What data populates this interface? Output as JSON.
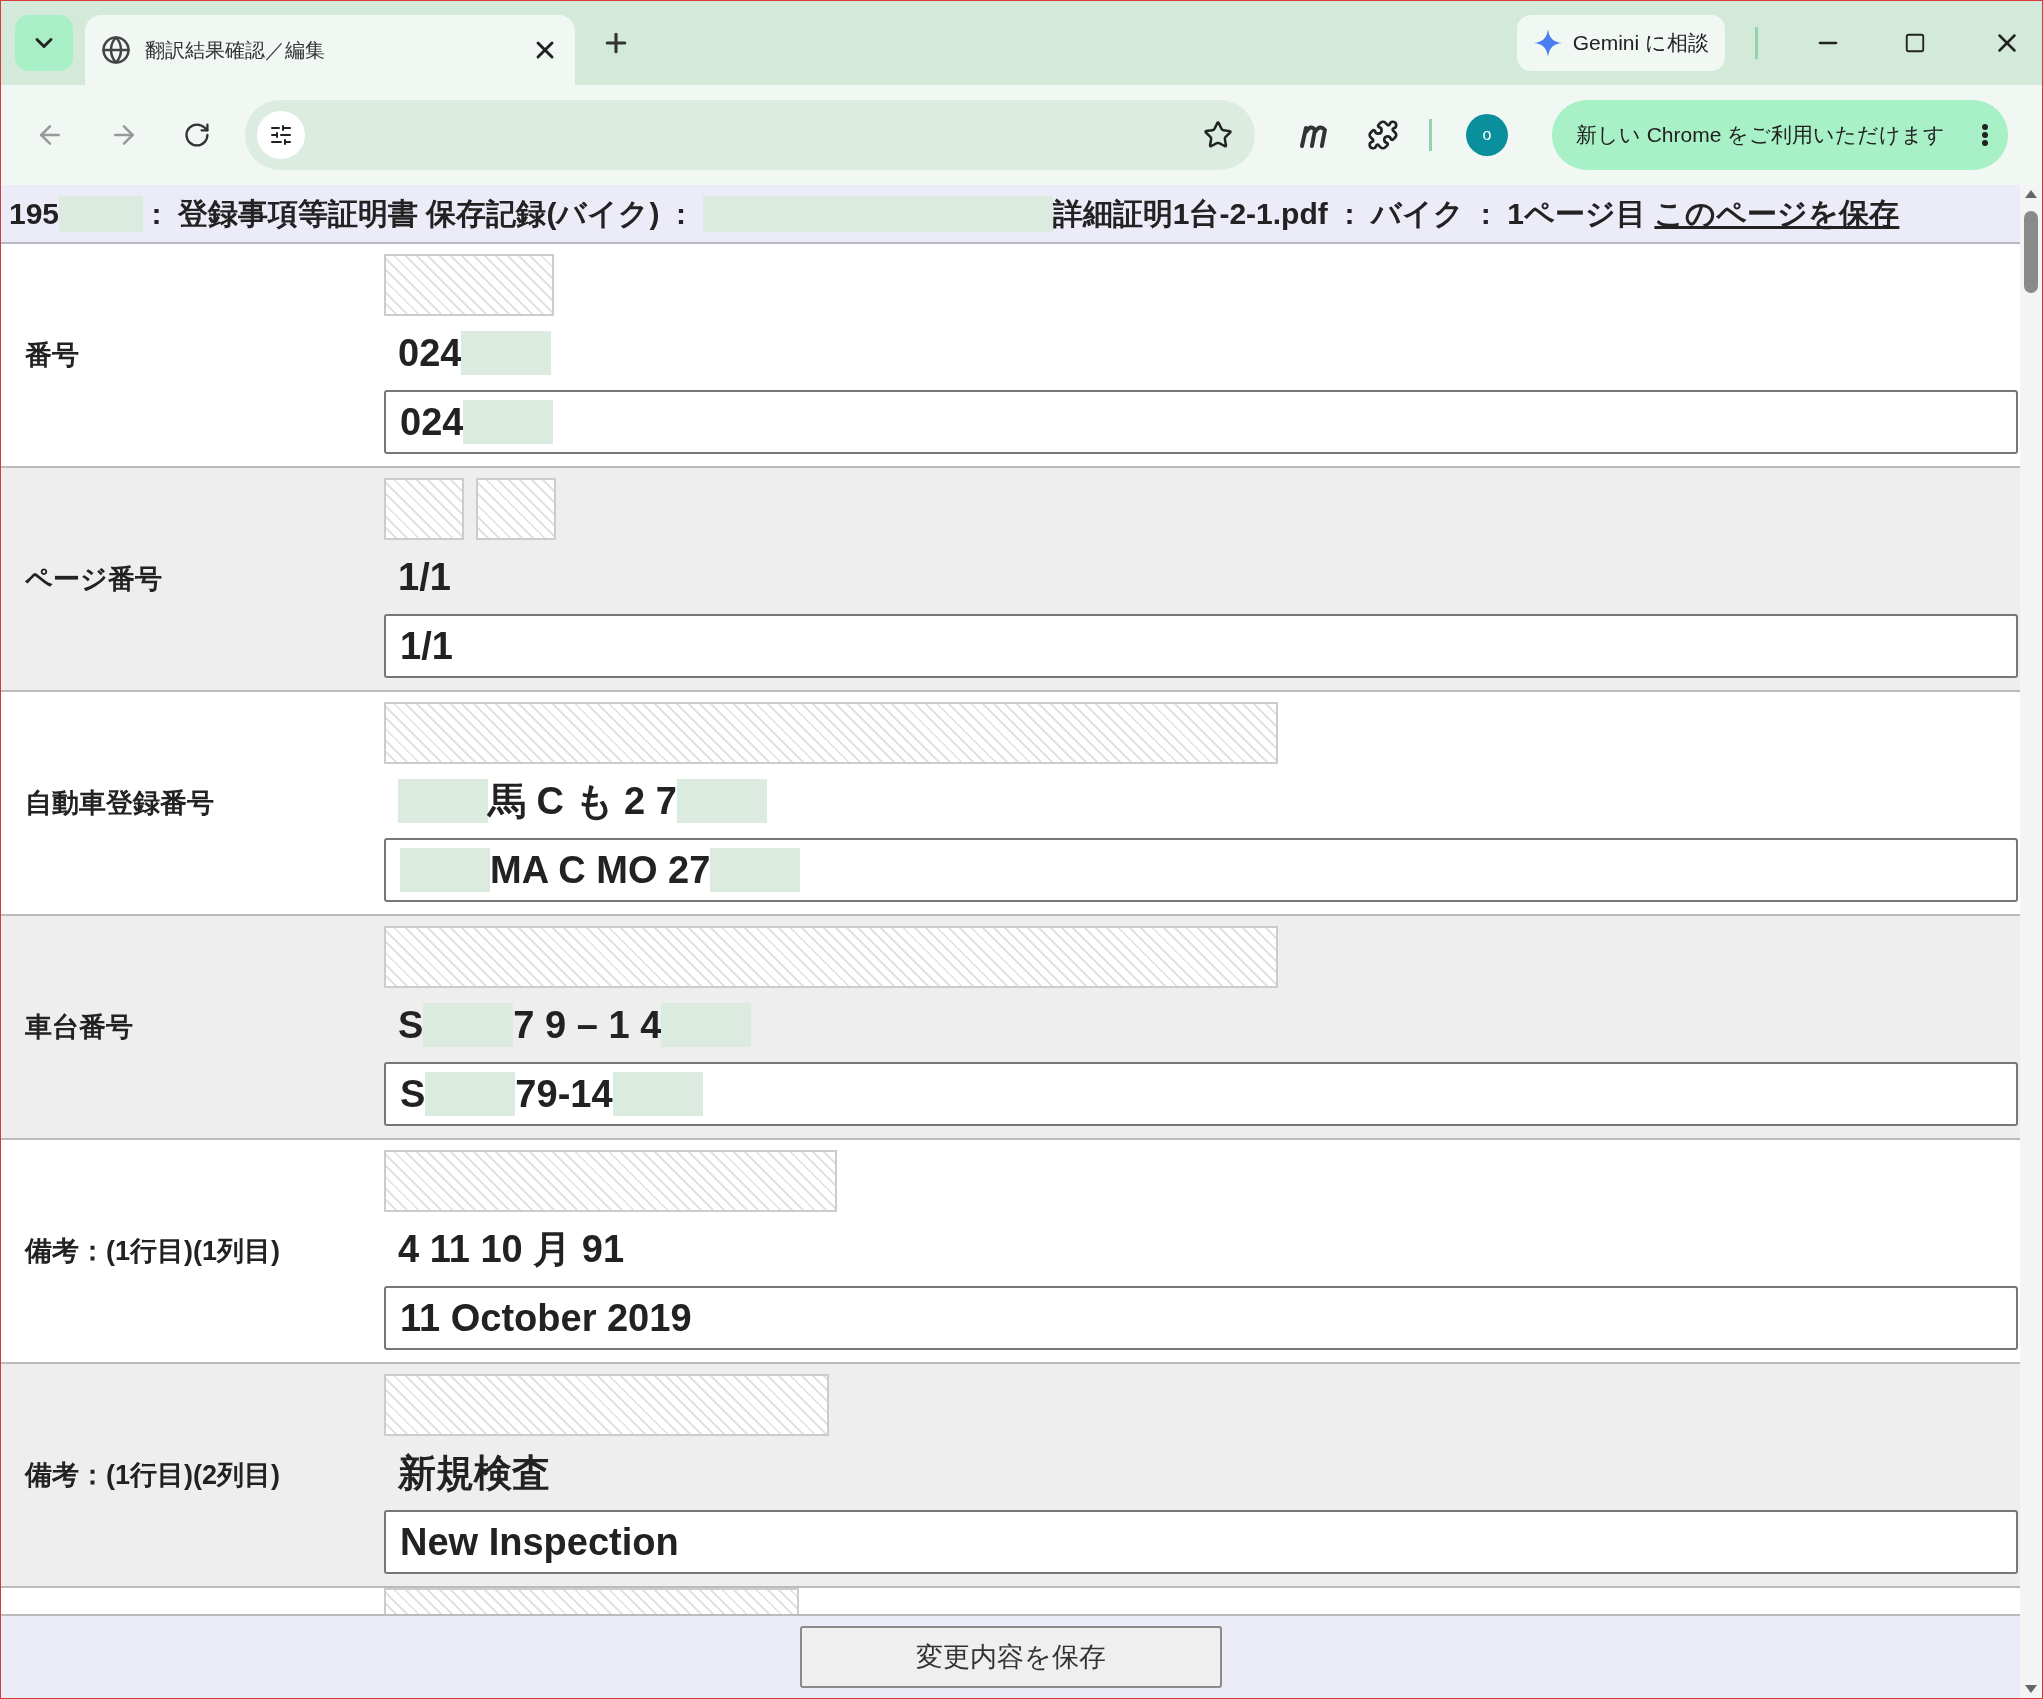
{
  "browser": {
    "tab_title": "翻訳結果確認／編集",
    "gemini_button": "Gemini に相談",
    "avatar_letter": "o",
    "update_banner": "新しい Chrome をご利用いただけます"
  },
  "header": {
    "parts": [
      {
        "kind": "text",
        "text": "195"
      },
      {
        "kind": "redacted"
      },
      {
        "kind": "text",
        "text": " :  登録事項等証明書 保存記録(バイク)  :  "
      },
      {
        "kind": "redacted"
      },
      {
        "kind": "text",
        "text": "詳細証明1台-2-1.pdf  :  バイク  :  1ページ目 "
      },
      {
        "kind": "link",
        "text": "このページを保存"
      }
    ]
  },
  "rows": [
    {
      "label": "番号",
      "ocr": [
        {
          "kind": "text",
          "text": "024"
        },
        {
          "kind": "redacted"
        }
      ],
      "translation": [
        {
          "kind": "text",
          "text": "024"
        },
        {
          "kind": "redacted"
        }
      ]
    },
    {
      "label": "ページ番号",
      "ocr": [
        {
          "kind": "text",
          "text": "1/1"
        }
      ],
      "translation": [
        {
          "kind": "text",
          "text": "1/1"
        }
      ]
    },
    {
      "label": "自動車登録番号",
      "ocr": [
        {
          "kind": "redacted"
        },
        {
          "kind": "text",
          "text": "馬 C も 2 7"
        },
        {
          "kind": "redacted"
        }
      ],
      "translation": [
        {
          "kind": "redacted"
        },
        {
          "kind": "text",
          "text": "MA C MO 27"
        },
        {
          "kind": "redacted"
        }
      ]
    },
    {
      "label": "車台番号",
      "ocr": [
        {
          "kind": "text",
          "text": "S"
        },
        {
          "kind": "redacted"
        },
        {
          "kind": "text",
          "text": "7 9 – 1 4"
        },
        {
          "kind": "redacted"
        }
      ],
      "translation": [
        {
          "kind": "text",
          "text": "S"
        },
        {
          "kind": "redacted"
        },
        {
          "kind": "text",
          "text": "79-14"
        },
        {
          "kind": "redacted"
        }
      ]
    },
    {
      "label": "備考：(1行目)(1列目)",
      "ocr": [
        {
          "kind": "text",
          "text": "4 11 10 月 91"
        }
      ],
      "translation": [
        {
          "kind": "text",
          "text": "11 October 2019"
        }
      ]
    },
    {
      "label": "備考：(1行目)(2列目)",
      "ocr": [
        {
          "kind": "text",
          "text": "新規検査"
        }
      ],
      "translation": [
        {
          "kind": "text",
          "text": "New Inspection"
        }
      ]
    }
  ],
  "save_button": "変更内容を保存"
}
